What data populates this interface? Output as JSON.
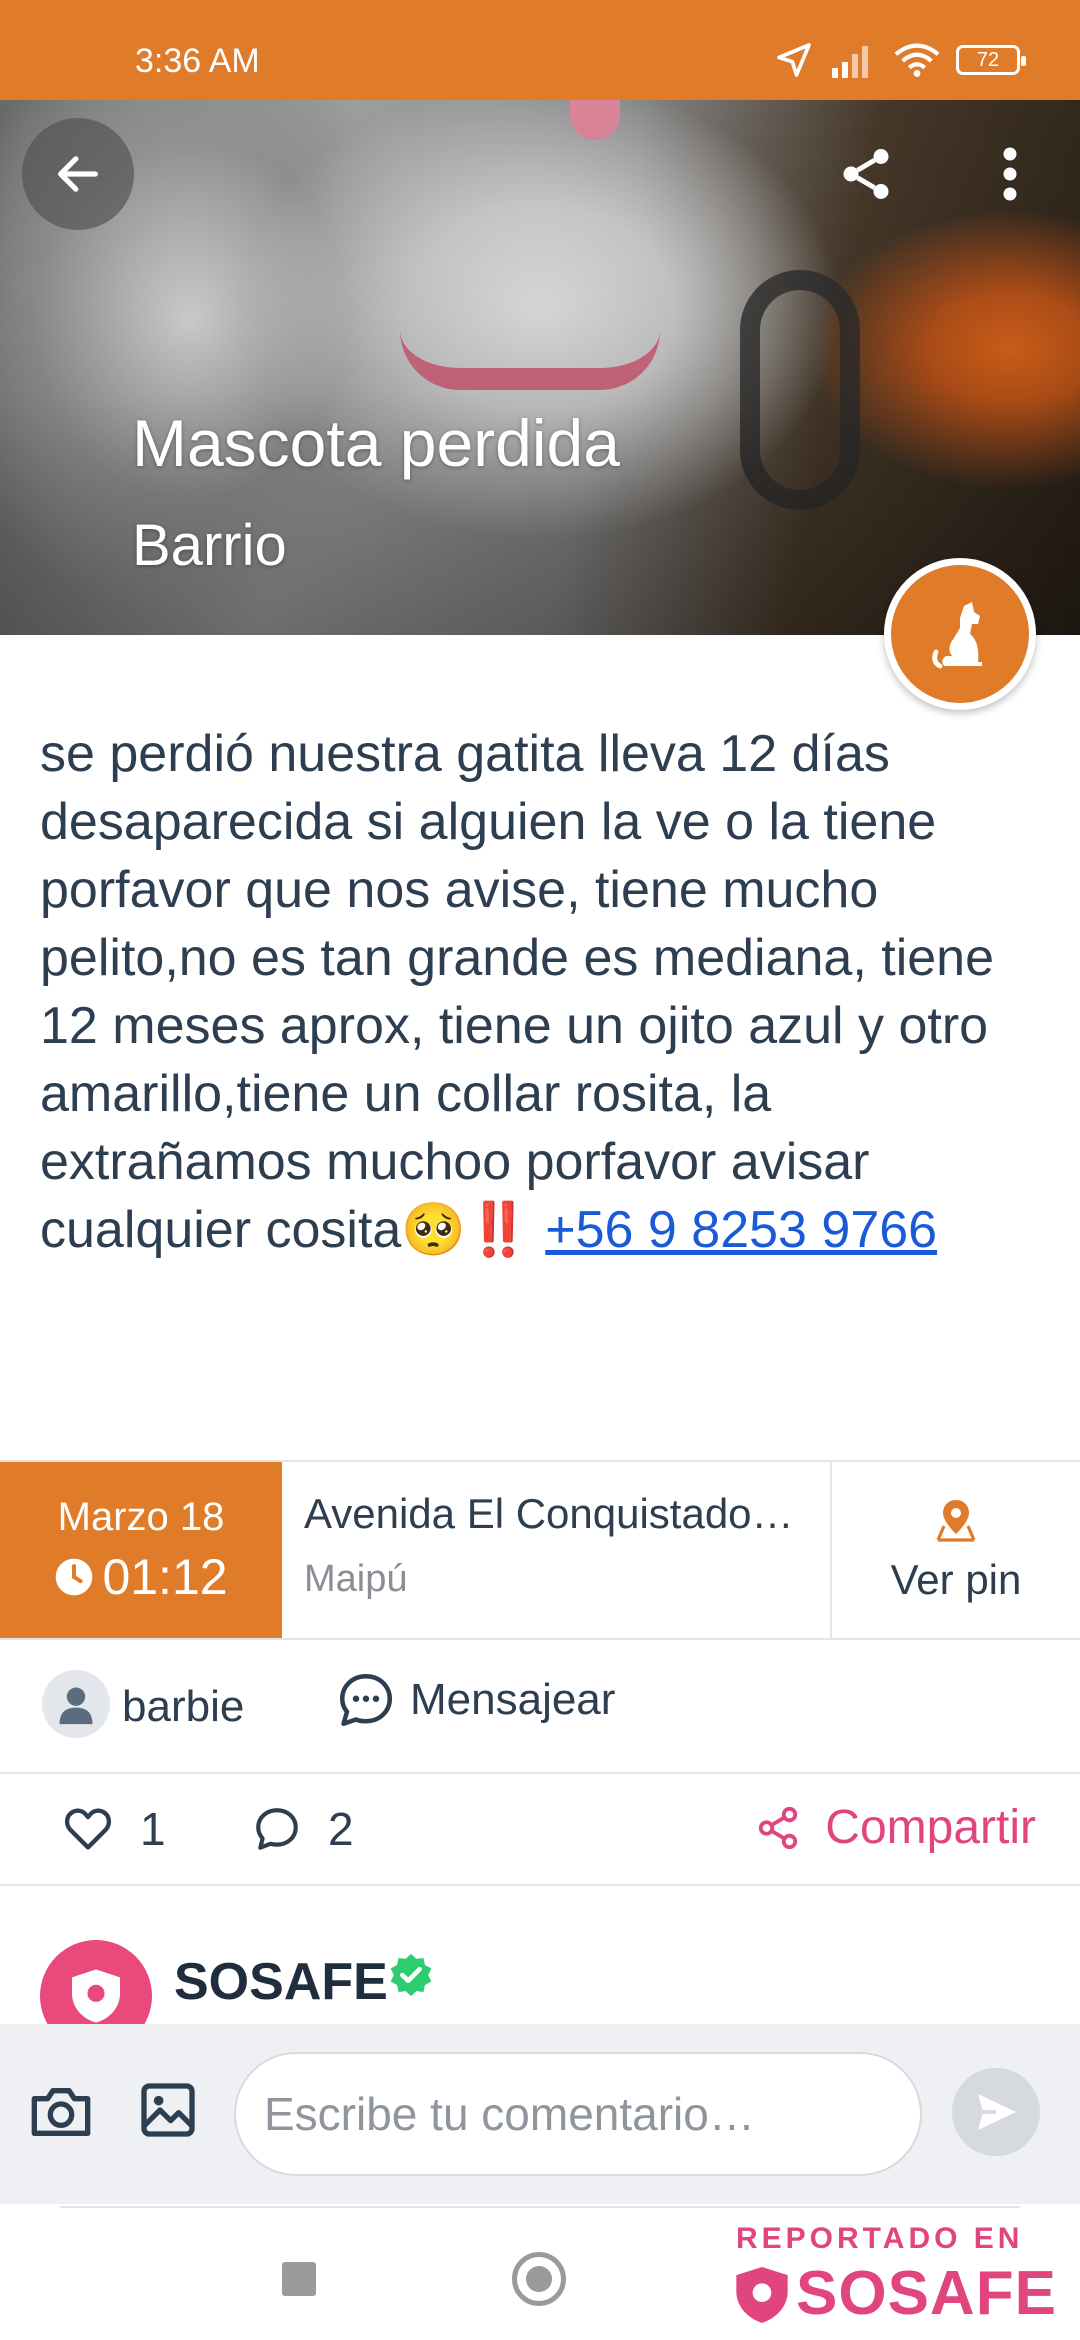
{
  "status_bar": {
    "time": "3:36 AM",
    "battery": "72"
  },
  "header": {
    "title": "Mascota perdida",
    "subtitle": "Barrio",
    "icons": [
      "arrow-left-icon",
      "share-icon",
      "more-vert-icon",
      "dog-icon"
    ]
  },
  "post": {
    "description": "se perdió nuestra gatita lleva 12 días desaparecida si alguien la ve o la tiene porfavor que nos avise, tiene mucho pelito,no es tan grande es mediana, tiene 12 meses aprox, tiene  un ojito azul y otro amarillo,tiene un collar rosita, la extrañamos muchoo porfavor avisar cualquier cosita🥺‼️ ",
    "phone": "+56 9 8253 9766"
  },
  "info": {
    "date": "Marzo 18",
    "time": "01:12",
    "street": "Avenida El Conquistado…",
    "commune": "Maipú",
    "pin_label": "Ver pin"
  },
  "user": {
    "name": "barbie",
    "message_label": "Mensajear"
  },
  "actions": {
    "likes": "1",
    "comments": "2",
    "share_label": "Compartir"
  },
  "comment_preview": {
    "author": "SOSAFE"
  },
  "comment_bar": {
    "placeholder": "Escribe tu comentario…"
  },
  "watermark": {
    "top": "REPORTADO EN",
    "brand": "SOSAFE"
  },
  "colors": {
    "accent_orange": "#e07b2a",
    "brand_pink": "#e0457f",
    "link_blue": "#1a5ad9",
    "verified_green": "#2ecc71"
  }
}
